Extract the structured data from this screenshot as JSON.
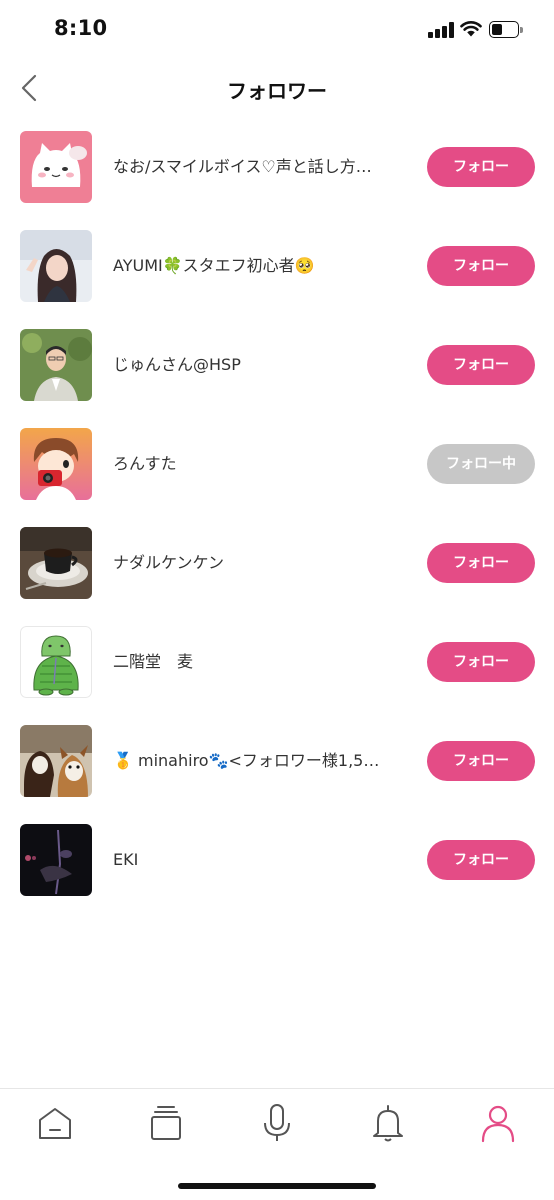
{
  "status_bar": {
    "time": "8:10"
  },
  "header": {
    "title": "フォロワー"
  },
  "colors": {
    "accent": "#e44c86",
    "following": "#c7c7c7"
  },
  "followers": [
    {
      "name": "なお/スマイルボイス♡声と話し方…",
      "button": "フォロー",
      "following": false,
      "avatar": "cat-illustration"
    },
    {
      "name": "AYUMI🍀スタエフ初心者🥺",
      "button": "フォロー",
      "following": false,
      "avatar": "woman-photo"
    },
    {
      "name": "じゅんさん@HSP",
      "button": "フォロー",
      "following": false,
      "avatar": "man-suit-photo"
    },
    {
      "name": "ろんすた",
      "button": "フォロー中",
      "following": true,
      "avatar": "camera-boy-illustration"
    },
    {
      "name": "ナダルケンケン",
      "button": "フォロー",
      "following": false,
      "avatar": "coffee-cup-photo"
    },
    {
      "name": "二階堂　麦",
      "button": "フォロー",
      "following": false,
      "avatar": "green-character-illustration"
    },
    {
      "name": "🥇 minahiro🐾<フォロワー様1,5…",
      "button": "フォロー",
      "following": false,
      "avatar": "dogs-photo"
    },
    {
      "name": "EKI",
      "button": "フォロー",
      "following": false,
      "avatar": "dark-photo"
    }
  ],
  "tab_bar": [
    {
      "name": "home",
      "icon": "home-icon",
      "active": false
    },
    {
      "name": "library",
      "icon": "stack-icon",
      "active": false
    },
    {
      "name": "record",
      "icon": "microphone-icon",
      "active": false
    },
    {
      "name": "notifications",
      "icon": "bell-icon",
      "active": false
    },
    {
      "name": "profile",
      "icon": "person-icon",
      "active": true
    }
  ]
}
